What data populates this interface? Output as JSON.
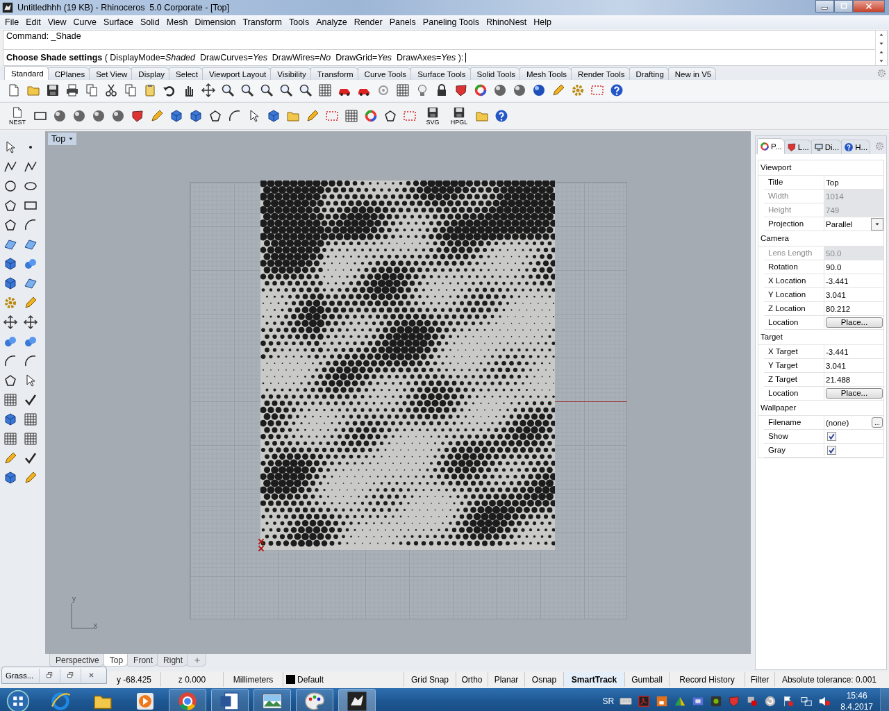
{
  "window": {
    "title": "Untitledhhh (19 KB) - Rhinoceros  5.0 Corporate - [Top]"
  },
  "menu": [
    "File",
    "Edit",
    "View",
    "Curve",
    "Surface",
    "Solid",
    "Mesh",
    "Dimension",
    "Transform",
    "Tools",
    "Analyze",
    "Render",
    "Panels",
    "Paneling Tools",
    "RhinoNest",
    "Help"
  ],
  "command": {
    "history": "Command: _Shade",
    "prompt": "**Choose Shade settings** ( DisplayMode=*Shaded*  DrawCurves=*Yes*  DrawWires=*No*  DrawGrid=*Yes*  DrawAxes=*Yes* ):"
  },
  "toolbar_tabs": [
    {
      "label": "Standard",
      "selected": true
    },
    {
      "label": "CPlanes",
      "selected": false
    },
    {
      "label": "Set View",
      "selected": false
    },
    {
      "label": "Display",
      "selected": false
    },
    {
      "label": "Select",
      "selected": false
    },
    {
      "label": "Viewport Layout",
      "selected": false
    },
    {
      "label": "Visibility",
      "selected": false
    },
    {
      "label": "Transform",
      "selected": false
    },
    {
      "label": "Curve Tools",
      "selected": false
    },
    {
      "label": "Surface Tools",
      "selected": false
    },
    {
      "label": "Solid Tools",
      "selected": false
    },
    {
      "label": "Mesh Tools",
      "selected": false
    },
    {
      "label": "Render Tools",
      "selected": false
    },
    {
      "label": "Drafting",
      "selected": false
    },
    {
      "label": "New in V5",
      "selected": false
    }
  ],
  "nest_toolbar": {
    "captions": [
      "NEST",
      "SVG",
      "HPGL"
    ]
  },
  "viewport": {
    "title": "Top",
    "axis_labels": [
      "y",
      "x"
    ]
  },
  "viewport_tabs": [
    {
      "label": "Perspective",
      "selected": false
    },
    {
      "label": "Top",
      "selected": true
    },
    {
      "label": "Front",
      "selected": false
    },
    {
      "label": "Right",
      "selected": false
    }
  ],
  "panel": {
    "tabs": [
      {
        "label": "P...",
        "kind": "properties",
        "selected": true
      },
      {
        "label": "L...",
        "kind": "layers",
        "selected": false
      },
      {
        "label": "Di...",
        "kind": "display",
        "selected": false
      },
      {
        "label": "H...",
        "kind": "help",
        "selected": false
      }
    ],
    "sections": [
      {
        "title": "Viewport",
        "rows": [
          {
            "label": "Title",
            "value": "Top",
            "kind": "text"
          },
          {
            "label": "Width",
            "value": "1014",
            "kind": "readonly"
          },
          {
            "label": "Height",
            "value": "749",
            "kind": "readonly"
          },
          {
            "label": "Projection",
            "value": "Parallel",
            "kind": "dropdown"
          }
        ]
      },
      {
        "title": "Camera",
        "rows": [
          {
            "label": "Lens Length",
            "value": "50.0",
            "kind": "readonly"
          },
          {
            "label": "Rotation",
            "value": "90.0",
            "kind": "text"
          },
          {
            "label": "X Location",
            "value": "-3.441",
            "kind": "text"
          },
          {
            "label": "Y Location",
            "value": "3.041",
            "kind": "text"
          },
          {
            "label": "Z Location",
            "value": "80.212",
            "kind": "text"
          },
          {
            "label": "Location",
            "value": "Place...",
            "kind": "button"
          }
        ]
      },
      {
        "title": "Target",
        "rows": [
          {
            "label": "X Target",
            "value": "-3.441",
            "kind": "text"
          },
          {
            "label": "Y Target",
            "value": "3.041",
            "kind": "text"
          },
          {
            "label": "Z Target",
            "value": "21.488",
            "kind": "text"
          },
          {
            "label": "Location",
            "value": "Place...",
            "kind": "button"
          }
        ]
      },
      {
        "title": "Wallpaper",
        "rows": [
          {
            "label": "Filename",
            "value": "(none)",
            "button_label": "...",
            "kind": "file"
          },
          {
            "label": "Show",
            "kind": "checkbox",
            "checked": true
          },
          {
            "label": "Gray",
            "kind": "checkbox",
            "checked": true
          }
        ]
      }
    ]
  },
  "floating_window": {
    "title": "Grass..."
  },
  "status_bar": {
    "readouts": [
      "y -68.425",
      "z 0.000",
      "Millimeters"
    ],
    "layer": {
      "name": "Default",
      "color": "#000000"
    },
    "toggles": [
      {
        "label": "Grid Snap",
        "on": false
      },
      {
        "label": "Ortho",
        "on": false
      },
      {
        "label": "Planar",
        "on": false
      },
      {
        "label": "Osnap",
        "on": false
      },
      {
        "label": "SmartTrack",
        "on": true
      },
      {
        "label": "Gumball",
        "on": false
      },
      {
        "label": "Record History",
        "on": false
      }
    ],
    "filter": "Filter",
    "tolerance": "Absolute tolerance: 0.001"
  },
  "taskbar": {
    "apps": [
      {
        "kind": "browser",
        "open": false,
        "selected": false
      },
      {
        "kind": "files",
        "open": false,
        "selected": false
      },
      {
        "kind": "media",
        "open": false,
        "selected": false
      },
      {
        "kind": "web",
        "open": true,
        "selected": false
      },
      {
        "kind": "writer",
        "open": true,
        "selected": false
      },
      {
        "kind": "photos",
        "open": true,
        "selected": false
      },
      {
        "kind": "paint",
        "open": true,
        "selected": false
      },
      {
        "kind": "cad",
        "open": true,
        "selected": true
      }
    ],
    "language": "SR",
    "time": "15:46",
    "date": "8.4.2017"
  }
}
